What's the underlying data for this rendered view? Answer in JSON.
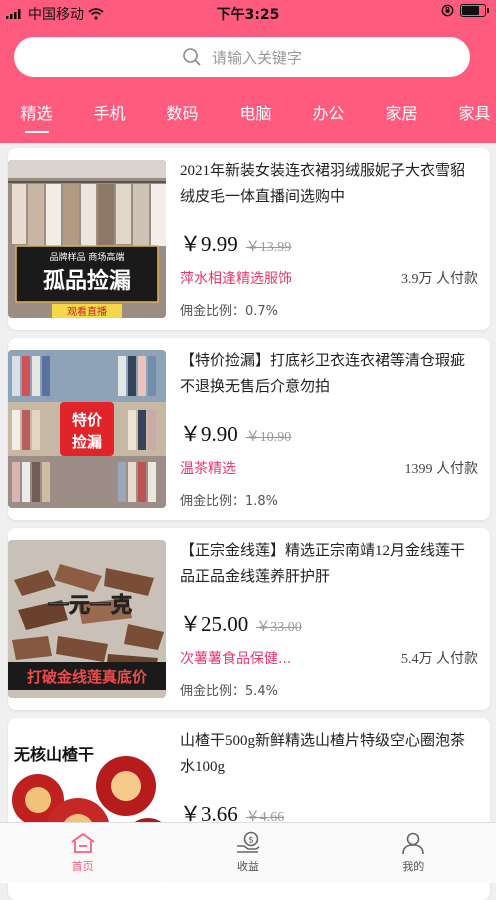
{
  "status": {
    "carrier": "中国移动",
    "time": "下午3:25",
    "battery_level": 0.85,
    "icons": [
      "signal-icon",
      "wifi-icon",
      "orientation-lock-icon",
      "battery-icon"
    ]
  },
  "search": {
    "placeholder": "请输入关键字",
    "icon": "search-icon"
  },
  "colors": {
    "brand": "#ff5b7e",
    "shop_name": "#e8386c",
    "thumb_badge_red": "#e0242a"
  },
  "tabs": [
    {
      "label": "精选",
      "active": true
    },
    {
      "label": "手机"
    },
    {
      "label": "数码"
    },
    {
      "label": "电脑"
    },
    {
      "label": "办公"
    },
    {
      "label": "家居"
    },
    {
      "label": "家具"
    }
  ],
  "products": [
    {
      "title": "2021年新装女装连衣裙羽绒服妮子大衣雪貂绒皮毛一体直播间选购中",
      "price": "￥9.99",
      "old_price": "￥13.99",
      "shop": "萍水相逢精选服饰",
      "sold": "3.9万 人付款",
      "commission": "佣金比例：0.7%",
      "thumb": {
        "top_text": "品牌样品 商场高端",
        "main_text": "孤品捡漏",
        "bottom_text": "观看直播"
      }
    },
    {
      "title": "【特价捡漏】打底衫卫衣连衣裙等清仓瑕疵不退换无售后介意勿拍",
      "price": "￥9.90",
      "old_price": "￥10.90",
      "shop": "温茶精选",
      "sold": "1399 人付款",
      "commission": "佣金比例：1.8%",
      "thumb": {
        "badge_line1": "特价",
        "badge_line2": "捡漏"
      }
    },
    {
      "title": "【正宗金线莲】精选正宗南靖12月金线莲干品正品金线莲养肝护肝",
      "price": "￥25.00",
      "old_price": "￥33.00",
      "shop": "次薯薯食品保健...",
      "sold": "5.4万 人付款",
      "commission": "佣金比例：5.4%",
      "thumb": {
        "main_text": "一元一克",
        "bottom_text": "打破金线莲真底价"
      }
    },
    {
      "title": "山楂干500g新鲜精选山楂片特级空心圈泡茶水100g",
      "price": "￥3.66",
      "old_price": "￥4.66",
      "shop": "",
      "sold": "",
      "commission": "",
      "thumb": {
        "top_text": "无核山楂干"
      }
    }
  ],
  "tabbar": [
    {
      "label": "首页",
      "icon": "home-icon",
      "active": true
    },
    {
      "label": "收益",
      "icon": "earnings-icon"
    },
    {
      "label": "我的",
      "icon": "profile-icon"
    }
  ]
}
